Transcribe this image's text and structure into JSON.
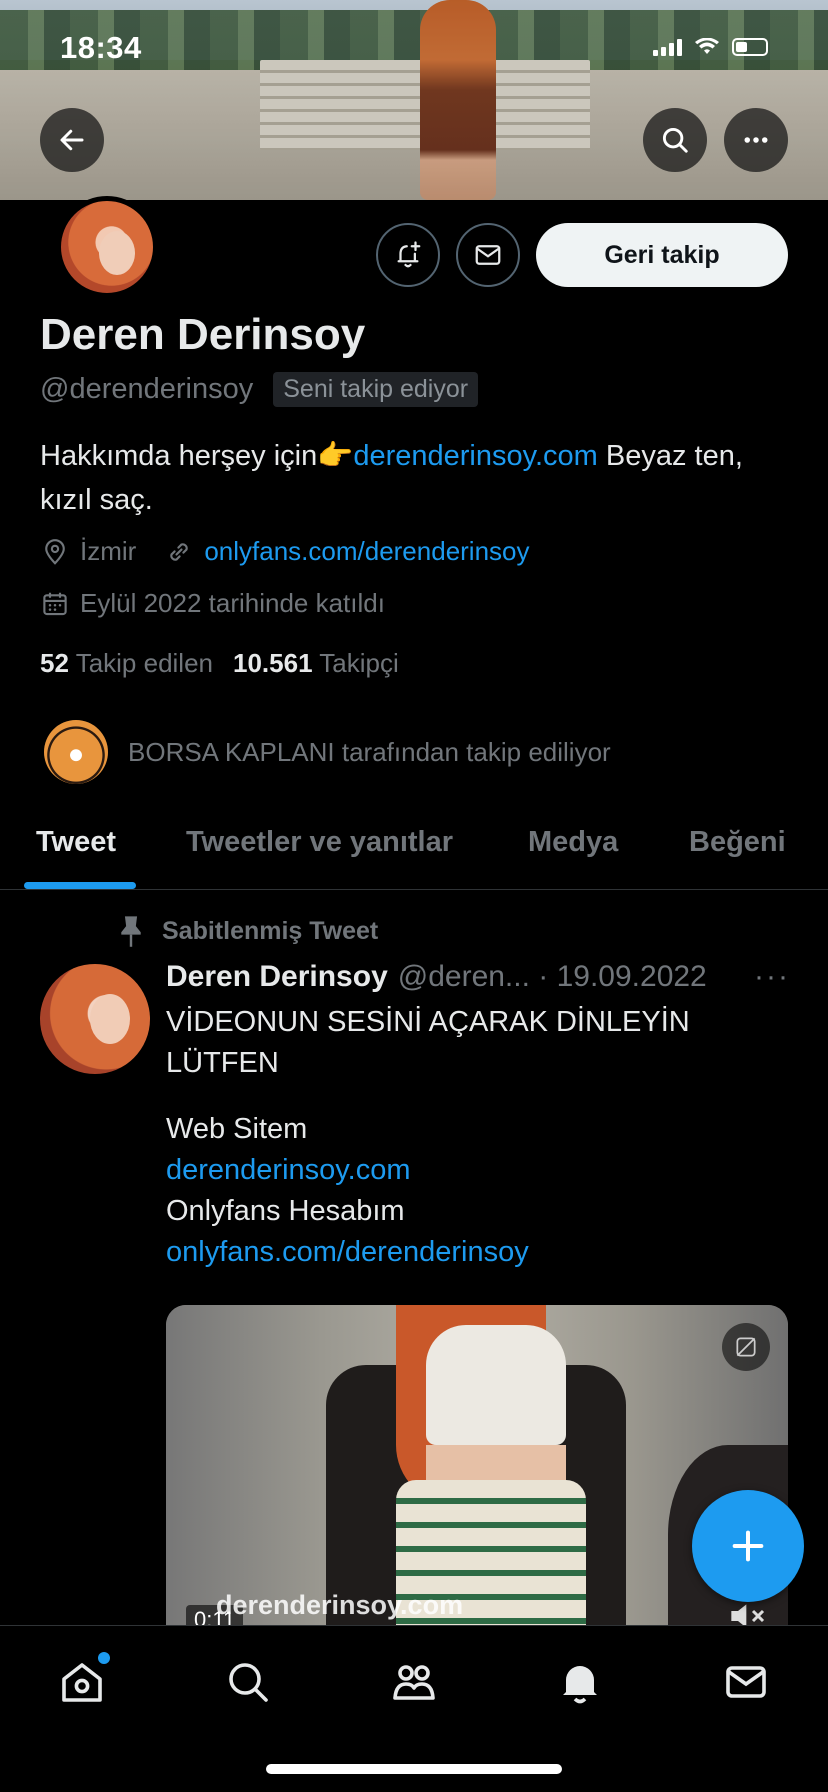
{
  "status_bar": {
    "time": "18:34"
  },
  "header": {
    "back_icon": "arrow-left-icon",
    "search_icon": "search-icon",
    "more_icon": "more-horizontal-icon"
  },
  "profile": {
    "display_name": "Deren Derinsoy",
    "handle": "@derenderinsoy",
    "follows_you": "Seni takip ediyor",
    "follow_back_label": "Geri takip",
    "bio_prefix": "Hakkımda herşey için👉",
    "bio_link": "derenderinsoy.com",
    "bio_suffix": " Beyaz ten, kızıl saç.",
    "location": "İzmir",
    "website": "onlyfans.com/derenderinsoy",
    "joined": "Eylül 2022 tarihinde katıldı",
    "following_count": "52",
    "following_label": "Takip edilen",
    "followers_count": "10.561",
    "followers_label": "Takipçi",
    "followed_by": "BORSA KAPLANI tarafından takip ediliyor"
  },
  "tabs": [
    {
      "label": "Tweet"
    },
    {
      "label": "Tweetler ve yanıtlar"
    },
    {
      "label": "Medya"
    },
    {
      "label": "Beğeni"
    }
  ],
  "pinned_tweet": {
    "pinned_label": "Sabitlenmiş Tweet",
    "name": "Deren Derinsoy",
    "handle_date": "@deren... · 19.09.2022",
    "more": "···",
    "line1": "VİDEONUN SESİNİ AÇARAK DİNLEYİN LÜTFEN",
    "line2": "Web Sitem",
    "link1": "derenderinsoy.com",
    "line3": "Onlyfans Hesabım",
    "link2": "onlyfans.com/derenderinsoy",
    "media_watermark": "derenderinsoy.com",
    "media_duration": "0:11"
  },
  "fab": {
    "icon": "plus-icon"
  },
  "bottom_nav": {
    "items": [
      "home-icon",
      "search-icon",
      "communities-icon",
      "notifications-icon",
      "messages-icon"
    ]
  },
  "colors": {
    "accent": "#1d9bf0",
    "background": "#000000",
    "secondary_text": "#71767b"
  }
}
